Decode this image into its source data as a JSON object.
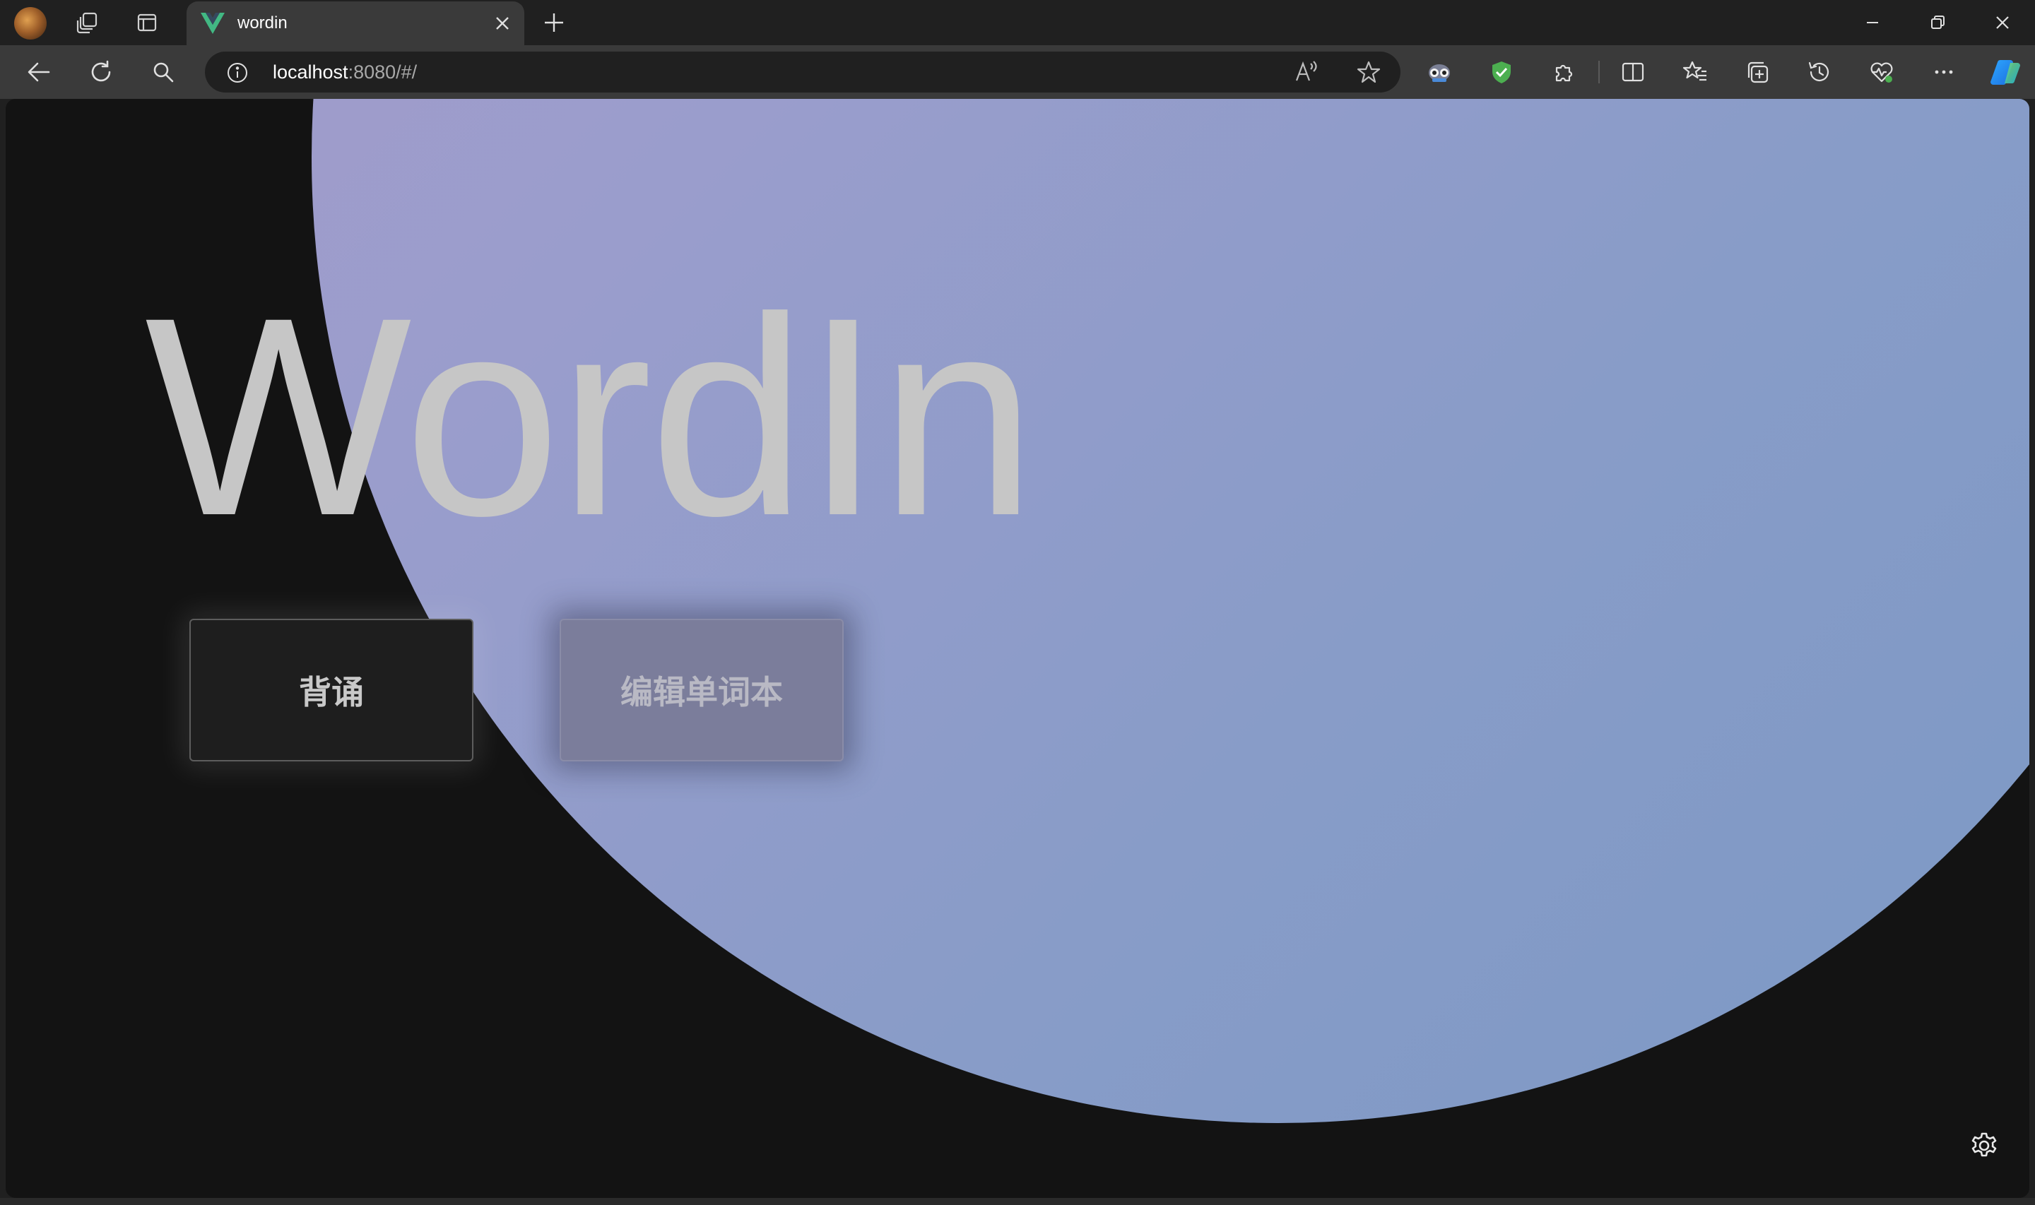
{
  "browser": {
    "tab": {
      "title": "wordin"
    },
    "address": {
      "host": "localhost",
      "rest": ":8080/#/"
    }
  },
  "page": {
    "logo": "WordIn",
    "buttons": {
      "recite": "背诵",
      "edit_wordbook": "编辑单词本"
    }
  },
  "icons": {
    "workspaces": "workspaces-icon",
    "tab_actions": "tab-actions-icon",
    "favicon": "vue-logo-icon",
    "settings": "gear-icon"
  },
  "colors": {
    "page_background": "#131313",
    "blob_start": "#a89bc9",
    "blob_end": "#7a98c4",
    "logo_text": "#c6c6c6",
    "vue_green": "#42b883",
    "shield_green": "#4caf50"
  }
}
